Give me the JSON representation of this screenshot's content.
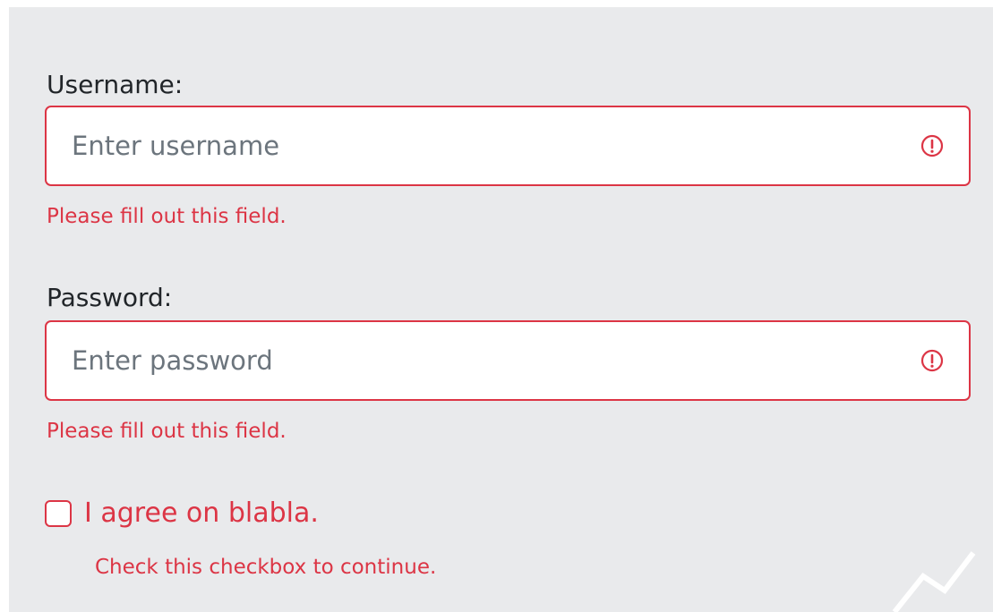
{
  "colors": {
    "panel_background": "#e9eaec",
    "invalid": "#dc3545",
    "placeholder": "#6c757d",
    "label": "#212529"
  },
  "form": {
    "username": {
      "label": "Username:",
      "placeholder": "Enter username",
      "value": "",
      "status_icon": "exclamation-circle-icon",
      "feedback": "Please fill out this field."
    },
    "password": {
      "label": "Password:",
      "placeholder": "Enter password",
      "value": "",
      "status_icon": "exclamation-circle-icon",
      "feedback": "Please fill out this field."
    },
    "agree": {
      "label": "I agree on blabla.",
      "checked": false,
      "feedback": "Check this checkbox to continue."
    }
  }
}
